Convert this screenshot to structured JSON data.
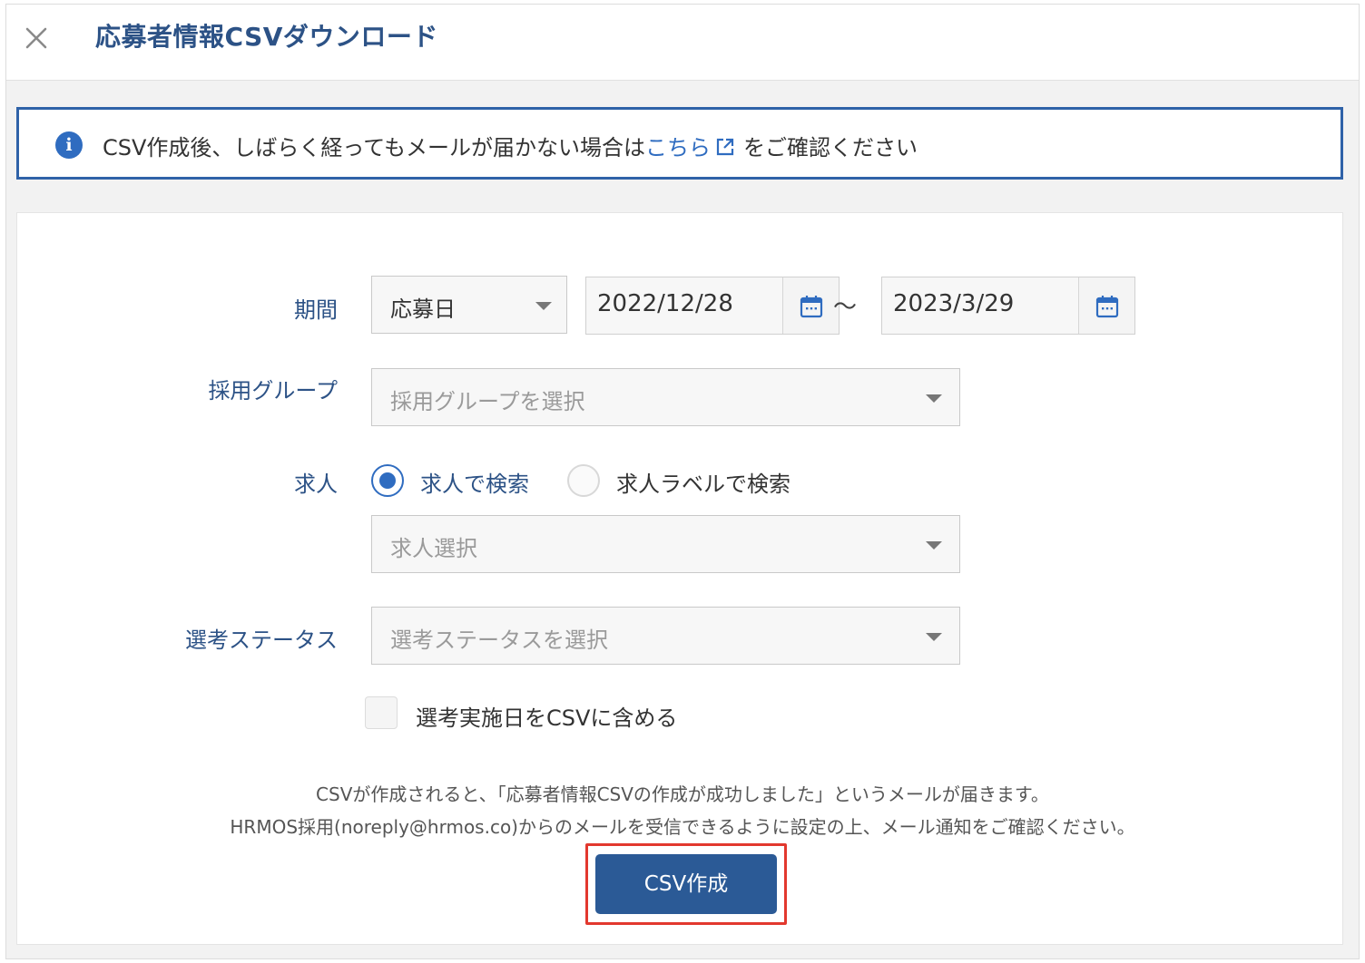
{
  "dialog": {
    "title": "応募者情報CSVダウンロード",
    "close_icon": "close-icon"
  },
  "notice": {
    "icon": "info-icon",
    "text_before": "CSV作成後、しばらく経ってもメールが届かない場合は",
    "link_text": "こちら",
    "link_icon": "external-link-icon",
    "text_after": "をご確認ください"
  },
  "form": {
    "period": {
      "label": "期間",
      "type_value": "応募日",
      "start_date": "2022/12/28",
      "separator": "〜",
      "end_date": "2023/3/29"
    },
    "group": {
      "label": "採用グループ",
      "placeholder": "採用グループを選択"
    },
    "job": {
      "label": "求人",
      "options": [
        {
          "label": "求人で検索",
          "selected": true
        },
        {
          "label": "求人ラベルで検索",
          "selected": false
        }
      ],
      "placeholder": "求人選択"
    },
    "status": {
      "label": "選考ステータス",
      "placeholder": "選考ステータスを選択"
    },
    "include_dates": {
      "label": "選考実施日をCSVに含める",
      "checked": false
    }
  },
  "footer": {
    "note_line1": "CSVが作成されると、「応募者情報CSVの作成が成功しました」というメールが届きます。",
    "note_line2": "HRMOS採用(noreply@hrmos.co)からのメールを受信できるように設定の上、メール通知をご確認ください。",
    "button_label": "CSV作成"
  },
  "colors": {
    "accent": "#2c5286",
    "link": "#2f6cc0",
    "button": "#2b5a96",
    "highlight": "#e2382e"
  }
}
